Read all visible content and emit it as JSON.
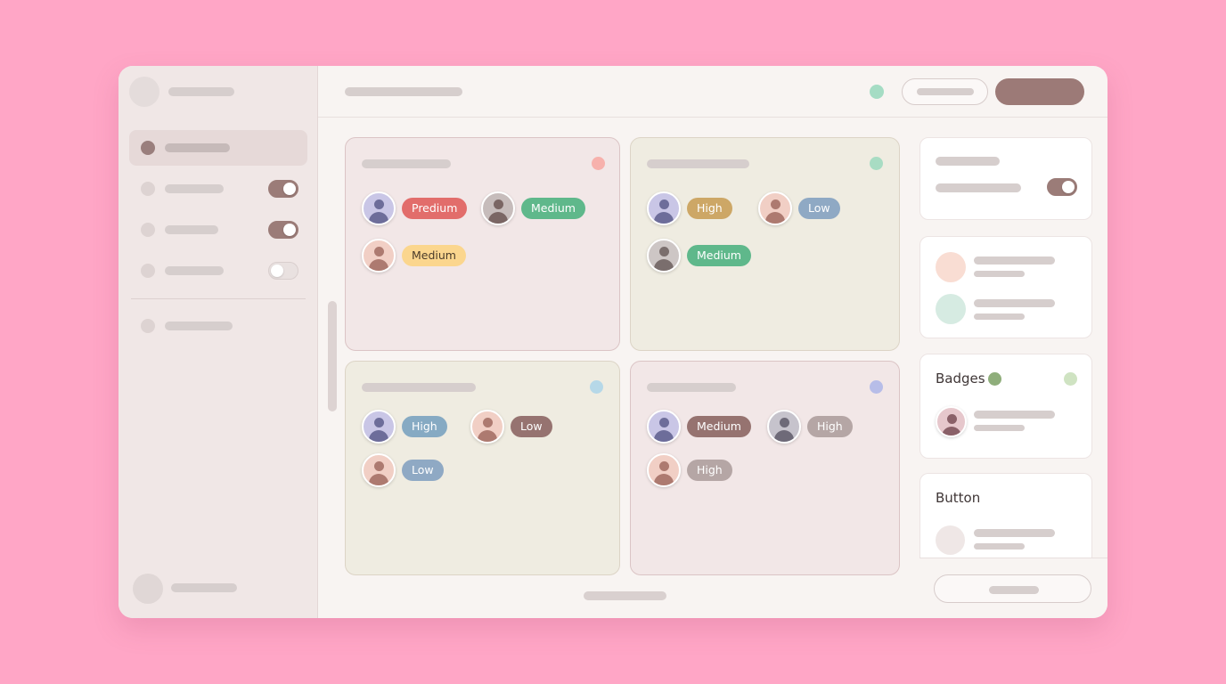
{
  "sidebar": {
    "items": [
      {
        "active": true,
        "toggle": null
      },
      {
        "active": false,
        "toggle": "on"
      },
      {
        "active": false,
        "toggle": "on"
      },
      {
        "active": false,
        "toggle": "off"
      },
      {
        "active": false,
        "toggle": null
      }
    ]
  },
  "cards": [
    {
      "assignments": [
        {
          "badge": "Predium",
          "badge_color": "#e26d6b",
          "avatar": "indigo"
        },
        {
          "badge": "Medium",
          "badge_color": "#5fb88b",
          "avatar": "gray"
        },
        {
          "badge": "Medium",
          "badge_color": "#fbd68e",
          "avatar": "peach"
        }
      ]
    },
    {
      "assignments": [
        {
          "badge": "High",
          "badge_color": "#cda766",
          "avatar": "indigo"
        },
        {
          "badge": "Low",
          "badge_color": "#8fa9c4",
          "avatar": "peach"
        },
        {
          "badge": "Medium",
          "badge_color": "#5fb88b",
          "avatar": "gray"
        }
      ]
    },
    {
      "assignments": [
        {
          "badge": "High",
          "badge_color": "#86aac3",
          "avatar": "indigo"
        },
        {
          "badge": "Low",
          "badge_color": "#967370",
          "avatar": "peach"
        },
        {
          "badge": "Low",
          "badge_color": "#8fa9c4",
          "avatar": "peach"
        }
      ]
    },
    {
      "assignments": [
        {
          "badge": "Medium",
          "badge_color": "#967370",
          "avatar": "indigo"
        },
        {
          "badge": "High",
          "badge_color": "#b5a6a5",
          "avatar": "gray"
        },
        {
          "badge": "High",
          "badge_color": "#b5a6a5",
          "avatar": "peach"
        }
      ]
    }
  ],
  "right_panel": {
    "badges_title": "Badges",
    "button_title": "Button"
  },
  "colors": {
    "primary": "#9c7a77",
    "page_background": "#ffa6c6"
  }
}
